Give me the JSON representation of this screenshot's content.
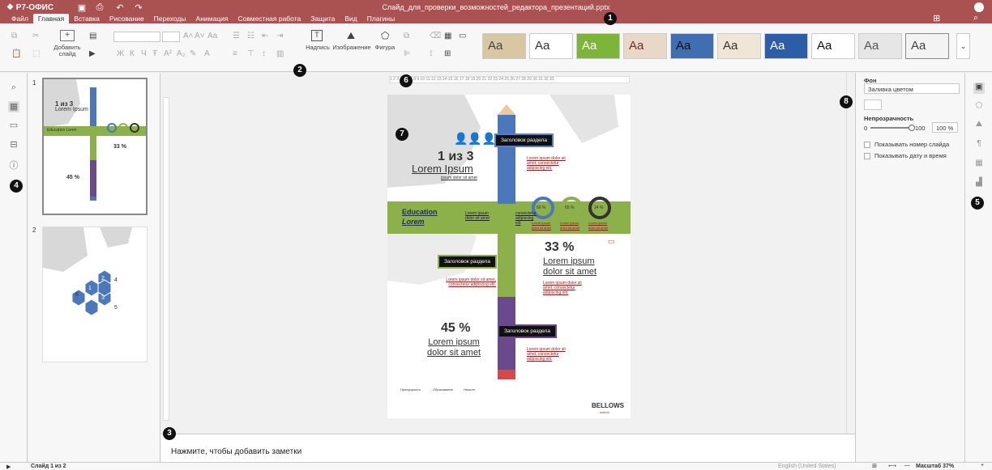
{
  "app": {
    "logo": "Р7-ОФИС",
    "doc_title": "Слайд_для_проверки_возможностей_редактора_презентаций.pptx"
  },
  "menu": [
    "Файл",
    "Главная",
    "Вставка",
    "Рисование",
    "Переходы",
    "Анимация",
    "Совместная работа",
    "Защита",
    "Вид",
    "Плагины"
  ],
  "toolbar": {
    "add_slide_label": "Добавить слайд",
    "textbox_label": "Надпись",
    "image_label": "Изображение",
    "shape_label": "Фигура",
    "font_buttons": [
      "Ж",
      "К",
      "Ч",
      "Ŧ",
      "A²",
      "A₂"
    ]
  },
  "themes": [
    {
      "label": "Aa",
      "bg": "#d9c7a3"
    },
    {
      "label": "Aa",
      "bg": "#ffffff"
    },
    {
      "label": "Aa",
      "bg": "#7db43a"
    },
    {
      "label": "Aa",
      "bg": "#e9d7c8"
    },
    {
      "label": "Aa",
      "bg": "#3f6fb0"
    },
    {
      "label": "Aa",
      "bg": "#efe6d6"
    },
    {
      "label": "Aa",
      "bg": "#2c5ea8"
    },
    {
      "label": "Aa",
      "bg": "#ffffff"
    },
    {
      "label": "Aa",
      "bg": "#e6e6e6"
    },
    {
      "label": "Aa",
      "bg": "#f3f3f3"
    }
  ],
  "thumbnails": [
    {
      "num": "1",
      "mini_stat": "1 из 3",
      "mini_title": "Lorem Ipsum",
      "mini_edu": "Education Loren",
      "mini_pct1": "33 %",
      "mini_pct2": "45 %"
    },
    {
      "num": "2",
      "hex_labels": [
        "2",
        "4",
        "6",
        "1",
        "3",
        "5"
      ]
    }
  ],
  "ruler_text": "1 2 3 4 5 6 7 8 9 10 11 12 13 14 15 16 17 18 19 20 21 22 23 24 25 26 27 28 29 30 31 32 33",
  "slide": {
    "stat": "1 из 3",
    "title": "Lorem Ipsum",
    "subtitle": "ipsum dolor sit amet",
    "section1": "Заголовок раздела",
    "section2": "Заголовок раздела",
    "section3": "Заголовок раздела",
    "link1": "Lorem ipsum dolor sit amet, consectetur adipiscing elit.",
    "education_1": "Education",
    "education_2": "Lorem",
    "edu_text": "Lorem ipsum dolor sit amet",
    "edu_text2": "consectetur adipiscing elit",
    "donut_values": [
      "60 %",
      "65 %",
      "24 %"
    ],
    "donut_captions": [
      "Lorem ipsum dolor sit amet",
      "Lorem ipsum dolor sit amet",
      "Lorem ipsum dolor sit amet"
    ],
    "pct1": "33 %",
    "pct1_title": "Lorem ipsum dolor sit amet",
    "pct1_link": "Lorem ipsum dolor sit amet, consectetur adipiscing elit.",
    "left_link2": "Lorem ipsum dolor sit amet, consectetur adipiscing elit.",
    "pct2": "45 %",
    "pct2_title": "Lorem ipsum dolor sit amet",
    "right_link3": "Lorem ipsum dolor sit amet, consectetur adipiscing elit.",
    "legend": [
      "Присущность",
      "Образование",
      "Начало"
    ],
    "brand": "BELLOWS",
    "brand_sub": "school"
  },
  "notes": {
    "placeholder": "Нажмите, чтобы добавить заметки"
  },
  "settings": {
    "bg_label": "Фон",
    "fill_value": "Заливка цветом",
    "opacity_label": "Непрозрачность",
    "opacity_min": "0",
    "opacity_max": "100",
    "opacity_value": "100 %",
    "show_slide_num": "Показывать номер слайда",
    "show_date": "Показывать дату и время"
  },
  "status": {
    "slide_info": "Слайд 1 из 2",
    "language": "English (United States)",
    "zoom": "Масштаб 37%"
  },
  "markers": [
    "1",
    "2",
    "3",
    "4",
    "5",
    "6",
    "7",
    "8"
  ]
}
